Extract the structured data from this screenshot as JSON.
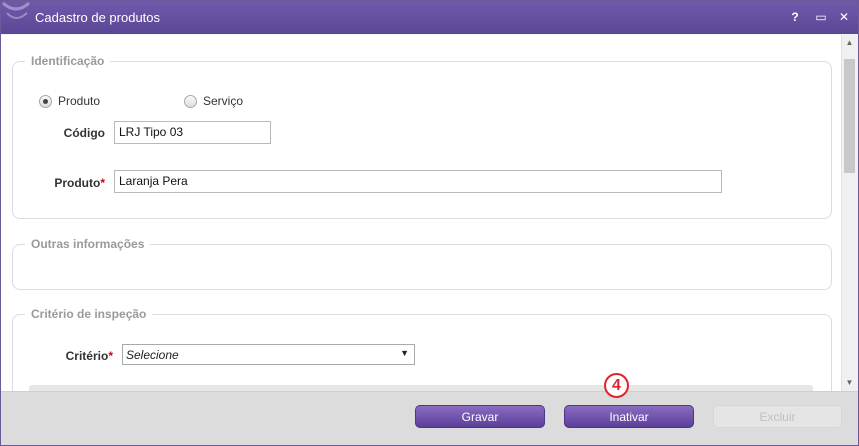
{
  "window": {
    "title": "Cadastro de produtos",
    "help_label": "?",
    "maximize_label": "▭",
    "close_label": "✕"
  },
  "identificacao": {
    "legend": "Identificação",
    "type_options": [
      {
        "label": "Produto",
        "selected": true
      },
      {
        "label": "Serviço",
        "selected": false
      }
    ],
    "codigo_label": "Código",
    "codigo_value": "LRJ Tipo 03",
    "produto_label": "Produto",
    "produto_required": "*",
    "produto_value": "Laranja Pera"
  },
  "outras_informacoes": {
    "legend": "Outras informações"
  },
  "criterio_inspecao": {
    "legend": "Critério de inspeção",
    "criterio_label": "Critério",
    "criterio_required": "*",
    "criterio_selected": "Selecione"
  },
  "footer": {
    "gravar_label": "Gravar",
    "inativar_label": "Inativar",
    "excluir_label": "Excluir",
    "step_badge": "4"
  },
  "colors": {
    "titlebar": "#5c4796",
    "button": "#6a4fad",
    "required": "#d0021b",
    "badge": "#e0232b"
  }
}
